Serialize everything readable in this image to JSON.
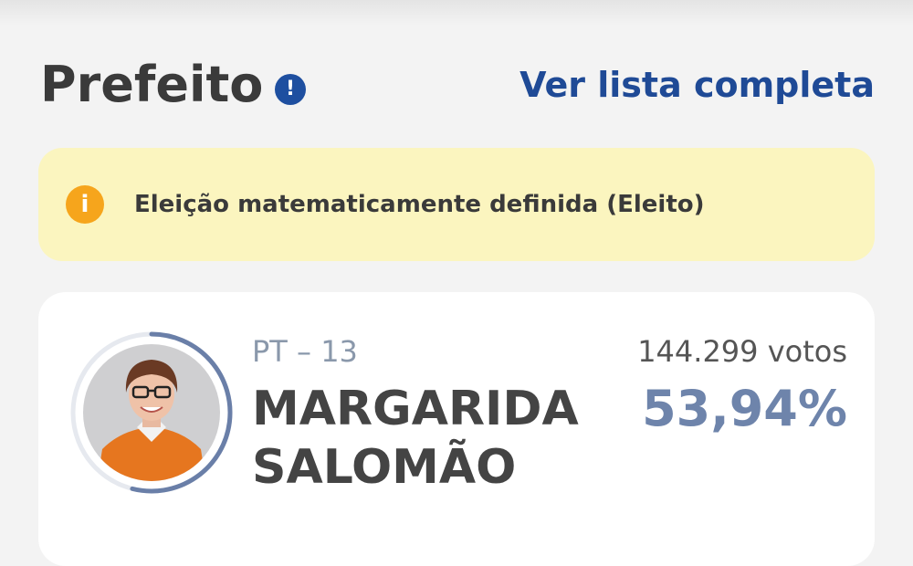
{
  "section": {
    "title": "Prefeito",
    "info_icon": "info-icon",
    "full_list_link": "Ver lista completa"
  },
  "alert": {
    "icon": "info-icon",
    "message": "Eleição matematicamente definida (Eleito)"
  },
  "candidate": {
    "party": "PT – 13",
    "name_line1": "MARGARIDA",
    "name_line2": "SALOMÃO",
    "votes": "144.299 votos",
    "percent": "53,94%",
    "vote_share": 0.5394
  },
  "colors": {
    "link": "#1f4a96",
    "alert_bg": "#fbf5bf",
    "alert_icon": "#f6a51c",
    "percent": "#6e84ab",
    "ring": "#6a7fa8"
  }
}
